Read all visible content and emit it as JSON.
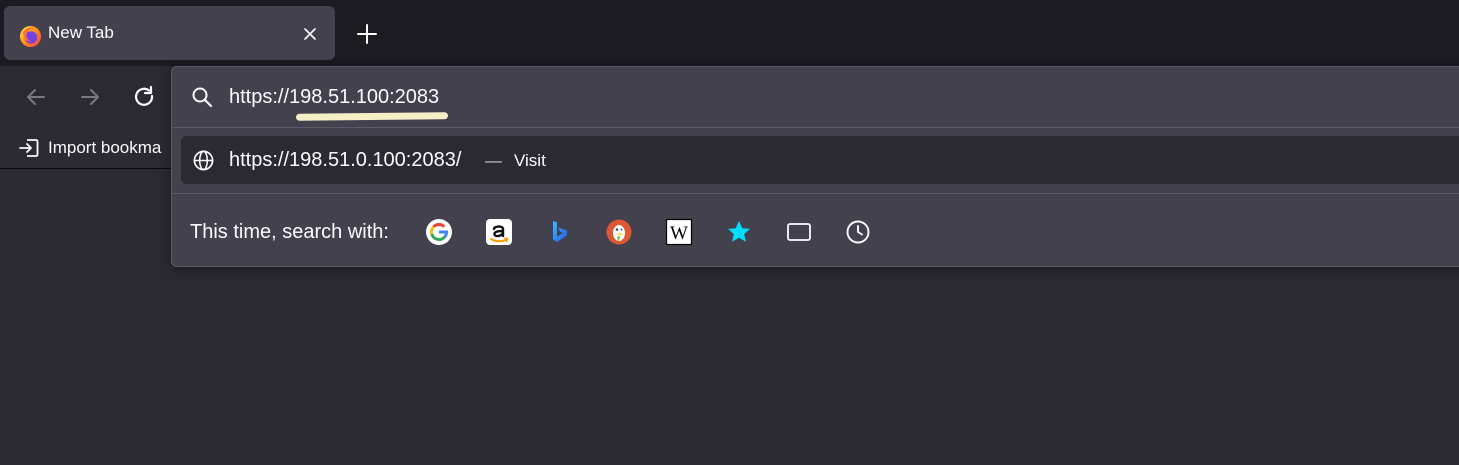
{
  "tab": {
    "title": "New Tab",
    "favicon": "firefox-icon"
  },
  "bookmarks": {
    "import_label": "Import bookma"
  },
  "urlbar": {
    "value": "https://198.51.100:2083",
    "search_icon": "search-icon",
    "suggestion": {
      "url": "https://198.51.0.100:2083/",
      "separator": "—",
      "action": "Visit",
      "icon": "globe-icon"
    },
    "search_with_label": "This time, search with:",
    "engines": [
      "google-icon",
      "amazon-icon",
      "bing-icon",
      "duckduckgo-icon",
      "wikipedia-icon",
      "bookmarks-star-icon",
      "tabs-icon",
      "history-icon"
    ]
  },
  "colors": {
    "tabstrip": "#1c1b22",
    "toolbar": "#2b2a33",
    "popup": "#42414d",
    "highlight": "#f5efc8",
    "star": "#00ddff"
  }
}
